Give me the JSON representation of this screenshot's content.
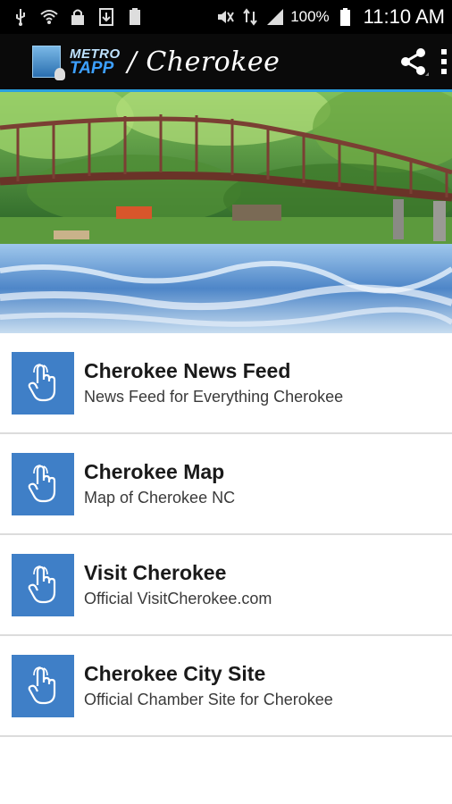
{
  "status_bar": {
    "battery_percent": "100%",
    "time": "11:10 AM",
    "icons": [
      "usb-icon",
      "wifi-icon",
      "lock-icon",
      "download-icon",
      "battery-100-icon",
      "mute-icon",
      "data-arrows-icon",
      "signal-icon",
      "battery-icon"
    ]
  },
  "action_bar": {
    "logo_metro": "METRO",
    "logo_tapp": "TAPP",
    "title": "/ Cherokee",
    "share_icon": "share-icon",
    "overflow_icon": "overflow-menu-icon"
  },
  "hero": {
    "image": "river-bridge-photo"
  },
  "list": {
    "items": [
      {
        "title": "Cherokee News Feed",
        "subtitle": "News Feed for Everything Cherokee",
        "icon": "tap-hand-icon"
      },
      {
        "title": "Cherokee Map",
        "subtitle": "Map of Cherokee NC",
        "icon": "tap-hand-icon"
      },
      {
        "title": "Visit Cherokee",
        "subtitle": "Official VisitCherokee.com",
        "icon": "tap-hand-icon"
      },
      {
        "title": "Cherokee City Site",
        "subtitle": "Official Chamber Site for Cherokee",
        "icon": "tap-hand-icon"
      }
    ]
  },
  "colors": {
    "accent": "#2aa0e0",
    "tile": "#3f7fc7",
    "actionbar": "#0a0a0a"
  }
}
